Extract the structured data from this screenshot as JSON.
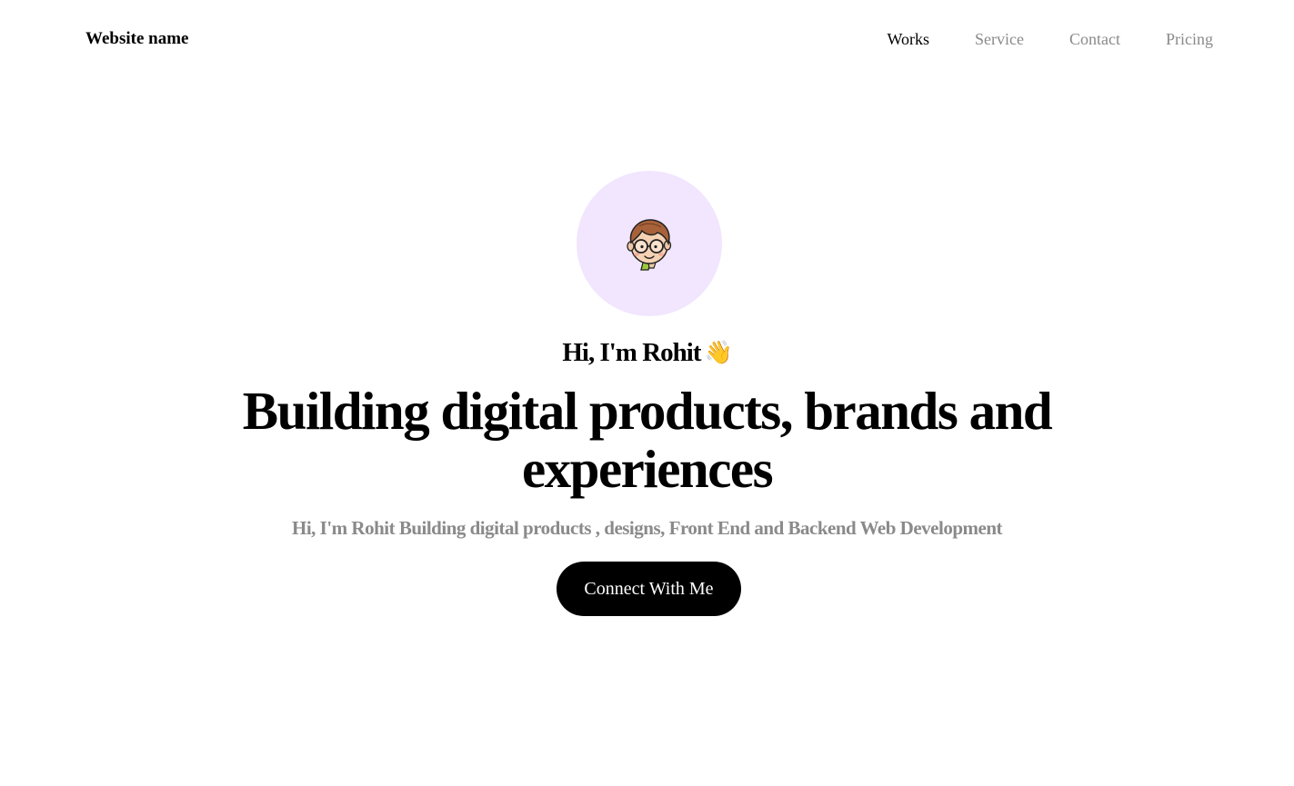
{
  "nav": {
    "brand": "Website name",
    "links": [
      {
        "label": "Works",
        "active": true
      },
      {
        "label": "Service",
        "active": false
      },
      {
        "label": "Contact",
        "active": false
      },
      {
        "label": "Pricing",
        "active": false
      }
    ]
  },
  "hero": {
    "avatar_icon": "cartoon-avatar-with-glasses",
    "avatar_bg_color": "#f1e6fe",
    "greeting": "Hi, I'm Rohit",
    "greeting_emoji": "👋",
    "headline_line1": "Building digital products, brands and",
    "headline_line2": "experiences",
    "subtitle": "Hi, I'm Rohit Building digital products , designs, Front End and Backend Web Development",
    "cta_label": "Connect With Me"
  },
  "colors": {
    "accent": "#000000",
    "muted_text": "#8a8a8a",
    "background": "#ffffff"
  }
}
